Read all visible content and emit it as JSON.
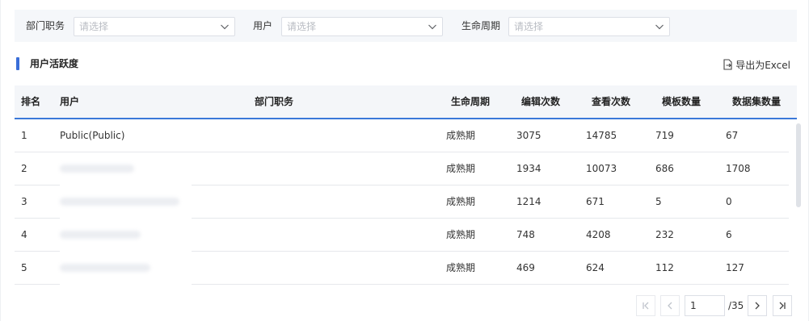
{
  "filters": [
    {
      "label": "部门职务",
      "placeholder": "请选择"
    },
    {
      "label": "用户",
      "placeholder": "请选择"
    },
    {
      "label": "生命周期",
      "placeholder": "请选择"
    }
  ],
  "section": {
    "title": "用户活跃度",
    "export_label": "导出为Excel",
    "export_icon": "export-icon"
  },
  "table": {
    "headers": [
      "排名",
      "用户",
      "部门职务",
      "生命周期",
      "编辑次数",
      "查看次数",
      "模板数量",
      "数据集数量"
    ],
    "rows": [
      {
        "rank": "1",
        "user": "Public(Public)",
        "dept": "",
        "lifecycle": "成熟期",
        "edits": "3075",
        "views": "14785",
        "templates": "719",
        "datasets": "67"
      },
      {
        "rank": "2",
        "user": "",
        "dept": "",
        "lifecycle": "成熟期",
        "edits": "1934",
        "views": "10073",
        "templates": "686",
        "datasets": "1708"
      },
      {
        "rank": "3",
        "user": "",
        "dept": "",
        "lifecycle": "成熟期",
        "edits": "1214",
        "views": "671",
        "templates": "5",
        "datasets": "0"
      },
      {
        "rank": "4",
        "user": "",
        "dept": "",
        "lifecycle": "成熟期",
        "edits": "748",
        "views": "4208",
        "templates": "232",
        "datasets": "6"
      },
      {
        "rank": "5",
        "user": "",
        "dept": "",
        "lifecycle": "成熟期",
        "edits": "469",
        "views": "624",
        "templates": "112",
        "datasets": "127"
      }
    ]
  },
  "pagination": {
    "current_page": "1",
    "total": "/35"
  },
  "colors": {
    "accent": "#3a78d9",
    "header_bg": "#f4f6f9",
    "filter_bg": "#f5f7fa"
  }
}
